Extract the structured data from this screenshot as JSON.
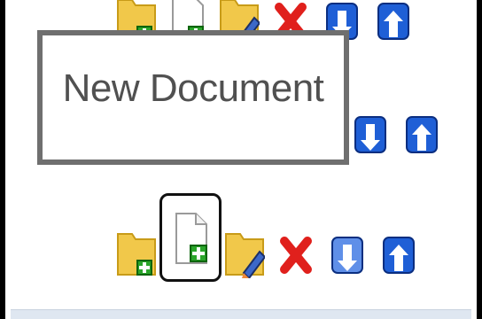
{
  "tooltip": {
    "text": "New Document"
  },
  "toolbar": {
    "tools": [
      "new-folder-icon",
      "new-document-icon",
      "rename-folder-icon",
      "delete-icon",
      "move-down-icon",
      "move-up-icon"
    ],
    "selected_tool": "new-document"
  },
  "colors": {
    "frame": "#000000",
    "tooltip_border": "#6f6f6f",
    "tooltip_text": "#505050",
    "arrow_blue": "#1f5fd6",
    "folder_yellow": "#f1c84a",
    "delete_red": "#e0201c",
    "plus_green": "#2aa52a"
  }
}
